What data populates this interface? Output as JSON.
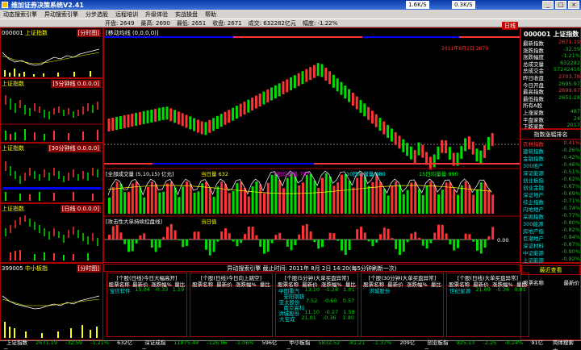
{
  "window": {
    "title": "维加证券决策系统V2.41",
    "net_down": "1.6K/S",
    "net_up": "0.3K/S",
    "min": "_",
    "max": "□",
    "close": "×"
  },
  "menu": [
    "动态搜索引擎",
    "异动搜索引擎",
    "分步选股",
    "远程培训",
    "升级体验",
    "实战操盘",
    "帮助"
  ],
  "toolbar": [
    "开盘: 2649",
    "最高: 2690",
    "最低: 2651",
    "收盘: 2671",
    "成交: 632282亿元",
    "幅度: -1.22%"
  ],
  "left_panels": [
    {
      "code": "000001",
      "name": "上证指数",
      "tag": "[分时图]"
    },
    {
      "code": "",
      "name": "上证指数",
      "tag": "[5分钟线 0.0.0.0]"
    },
    {
      "code": "",
      "name": "上证指数",
      "tag": "[30分钟线 0.0.0.0]"
    },
    {
      "code": "",
      "name": "上证指数",
      "tag": "[日线 0.0.0.0]"
    },
    {
      "code": "399005",
      "name": "中小板指",
      "tag": "[分时图]"
    }
  ],
  "main": {
    "title": "[移动均线 (0,0,0,0)]",
    "date_label": "2011年8月2日 2670",
    "vol_title": "[全部成交量 (5,10,15) 亿元]",
    "vol_labels": [
      "当日量 632",
      "5日均量量 797",
      "10日均量量 880",
      "15日均量量 990"
    ],
    "macd_title": "[攻击性大单持续控盘线]",
    "macd_label": "当日值",
    "macd_zero": "0.00",
    "day_badge": "日线"
  },
  "quote": {
    "code": "000001",
    "name": "上证指数",
    "rows": [
      {
        "k": "最新指数",
        "v": "2671.19"
      },
      {
        "k": "涨跌指数",
        "v": "-32.59"
      },
      {
        "k": "涨跌幅度",
        "v": "-1.21%"
      },
      {
        "k": "总成交量",
        "v": "632282"
      },
      {
        "k": "总成交金",
        "v": "57242416"
      },
      {
        "k": "昨日收盘",
        "v": "2703.78"
      },
      {
        "k": "今日开盘",
        "v": "2695.97"
      },
      {
        "k": "最高指数",
        "v": "2699.97"
      },
      {
        "k": "最低指数",
        "v": "2651.28"
      },
      {
        "k": "所有A股",
        "v": ""
      },
      {
        "k": "上涨家数",
        "v": "487"
      },
      {
        "k": "平盘家数",
        "v": "24"
      },
      {
        "k": "下跌家数",
        "v": "2017"
      }
    ]
  },
  "rank": {
    "title": "指数涨幅排名",
    "rows": [
      {
        "k": "农林指数",
        "v": "0.41%"
      },
      {
        "k": "建筑指数",
        "v": "-0.26%"
      },
      {
        "k": "金融指数",
        "v": "-0.42%"
      },
      {
        "k": "300地产",
        "v": "-0.46%"
      },
      {
        "k": "深证能源",
        "v": "-0.51%"
      },
      {
        "k": "创业板指",
        "v": "-0.62%"
      },
      {
        "k": "创业金融",
        "v": "-0.67%"
      },
      {
        "k": "深证地产",
        "v": "-0.69%"
      },
      {
        "k": "综企指数",
        "v": "-0.71%"
      },
      {
        "k": "内地地产",
        "v": "-0.74%"
      },
      {
        "k": "采掘指数",
        "v": "-0.77%"
      },
      {
        "k": "300能源",
        "v": "-0.80%"
      },
      {
        "k": "房地产指",
        "v": "-0.82%"
      },
      {
        "k": "巨潮地产",
        "v": "-0.84%"
      },
      {
        "k": "深证材料",
        "v": "-0.87%"
      },
      {
        "k": "中证能源",
        "v": "-0.90%"
      },
      {
        "k": "上证能源",
        "v": "-0.92%"
      }
    ],
    "recent_title": "最近查看",
    "recent_head": [
      "股票名称",
      "最新价"
    ]
  },
  "bottom": {
    "header": "异动搜索引擎  截止时间: 2011年 8月 2日 14:20(每5分钟刷新一次)",
    "tables": [
      {
        "title": "[个股(日线)今日大幅高开]",
        "cols": [
          "股票名称",
          "最新价",
          "涨跌幅%",
          "量比"
        ],
        "rows": [
          [
            "宝信软件",
            "15.04",
            "-0.33",
            "1.19"
          ]
        ]
      },
      {
        "title": "[个股(日线)今日向上跳空]",
        "cols": [
          "股票名称",
          "最新价",
          "涨跌幅%",
          "量比"
        ],
        "rows": []
      },
      {
        "title": "[个股(5分钟)大单买盘异常]",
        "cols": [
          "股票名称",
          "最新价",
          "涨跌幅%",
          "量比"
        ],
        "rows": [
          [
            "中国重汽",
            "13.10",
            "-1.28",
            "1.01"
          ],
          [
            "安阳钢铁",
            "",
            "",
            ""
          ],
          [
            "亚太股份",
            "7.52",
            "-0.60",
            "0.57"
          ],
          [
            "南京高科",
            "",
            "",
            ""
          ],
          [
            "洪城股份",
            "11.10",
            "-0.27",
            "1.58"
          ],
          [
            "大宝成",
            "21.01",
            "-0.36",
            "1.80"
          ]
        ]
      },
      {
        "title": "[个股(30分钟)大单买盘异常]",
        "cols": [
          "股票名称",
          "最新价",
          "涨跌幅%",
          "量比"
        ],
        "rows": [
          [
            "洪城股份",
            "",
            "",
            ""
          ]
        ]
      },
      {
        "title": "[个股(日线)大单买盘异常]",
        "cols": [
          "股票名称",
          "最新价",
          "涨跌幅%",
          "量比"
        ],
        "rows": [
          [
            "世纪星源",
            "21.69",
            "-0.36",
            "0.81"
          ]
        ]
      }
    ]
  },
  "status": [
    {
      "k": "上证指数",
      "v": "2671.19",
      "c": "-32.59",
      "p": "-1.21%",
      "a": "632亿元"
    },
    {
      "k": "深证成指",
      "v": "11875.48",
      "c": "-126.96",
      "p": "-1.06%",
      "a": "596亿元"
    },
    {
      "k": "中小板指",
      "v": "5832.52",
      "c": "-81.21",
      "p": "-1.37%",
      "a": "209亿元"
    },
    {
      "k": "创业板指",
      "v": "925.13",
      "c": "-2.25",
      "p": "-0.24%",
      "a": "91亿元"
    }
  ],
  "status_end": "简体搜索中"
}
